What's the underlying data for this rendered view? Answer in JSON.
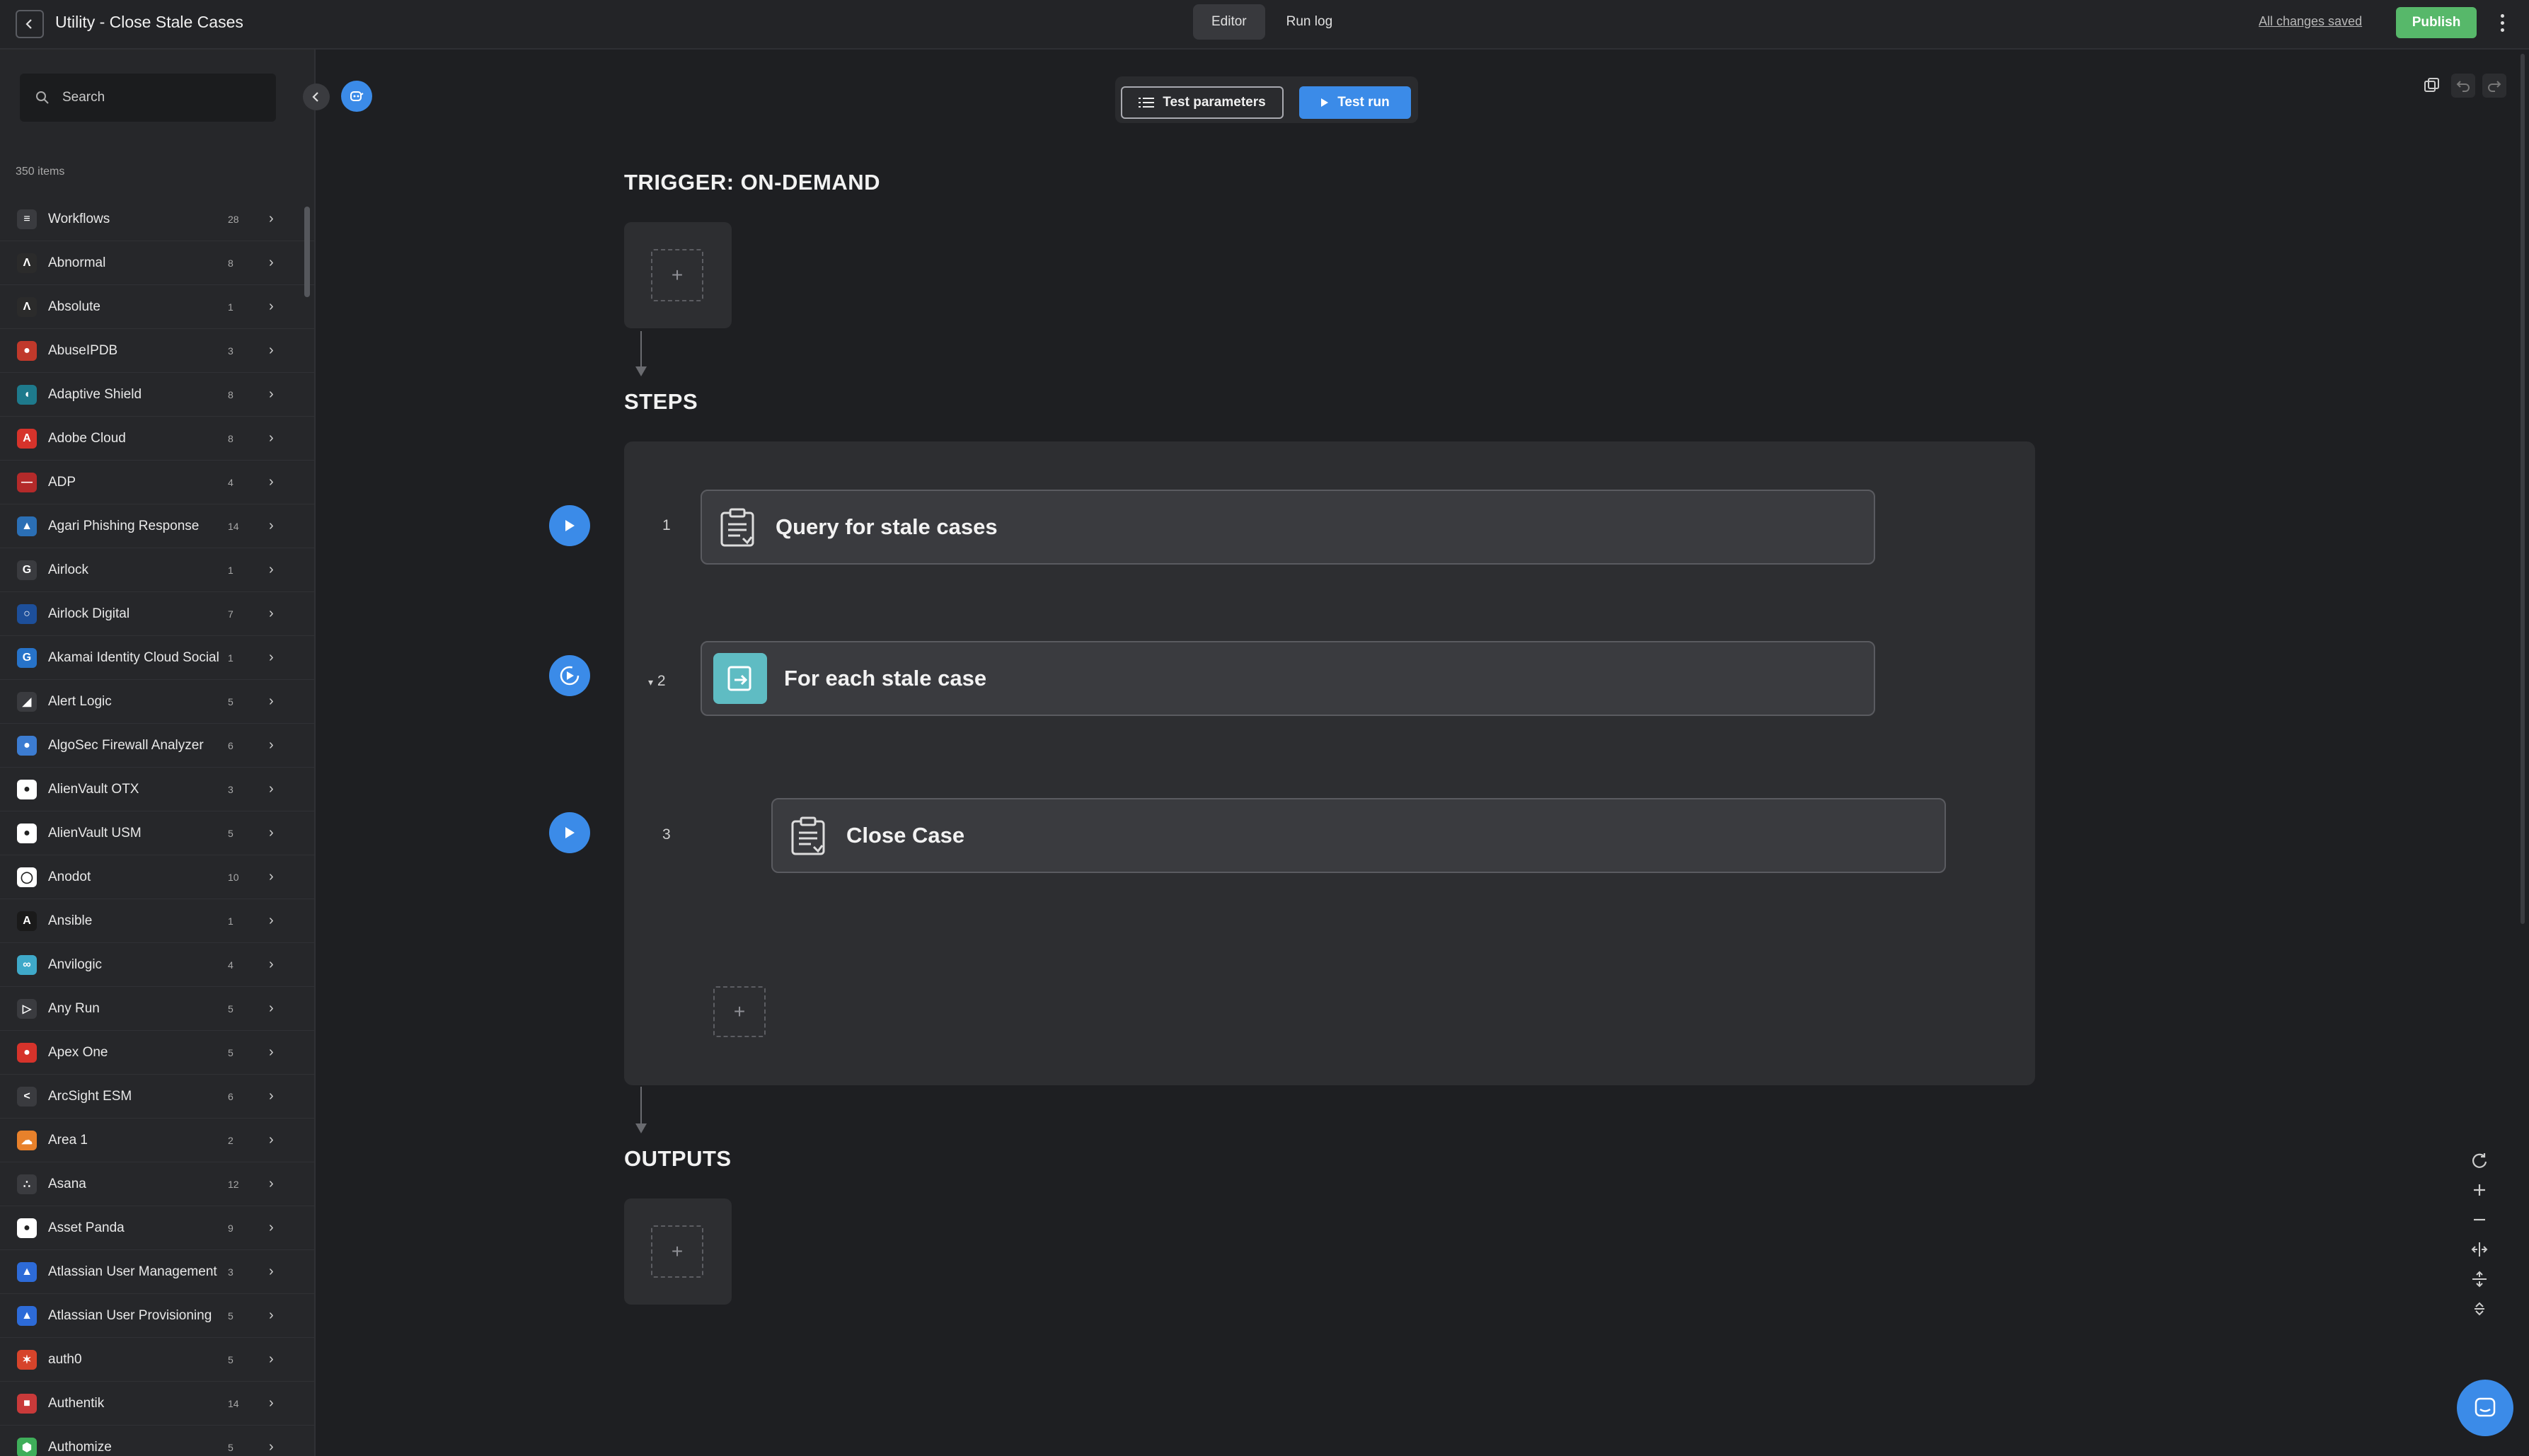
{
  "header": {
    "title": "Utility - Close Stale Cases",
    "tabs": [
      "Editor",
      "Run log"
    ],
    "saved_status": "All changes saved",
    "publish_label": "Publish"
  },
  "sidebar": {
    "search_placeholder": "Search",
    "count_label": "350 items",
    "items": [
      {
        "label": "Workflows",
        "count": "28",
        "color": "#3a3b3f",
        "glyph": "≡"
      },
      {
        "label": "Abnormal",
        "count": "8",
        "color": "#2b2b2b",
        "glyph": "Λ"
      },
      {
        "label": "Absolute",
        "count": "1",
        "color": "#2b2b2b",
        "glyph": "Λ"
      },
      {
        "label": "AbuseIPDB",
        "count": "3",
        "color": "#c0392b",
        "glyph": "●"
      },
      {
        "label": "Adaptive Shield",
        "count": "8",
        "color": "#1e7a8c",
        "glyph": "◖"
      },
      {
        "label": "Adobe Cloud",
        "count": "8",
        "color": "#d6332b",
        "glyph": "A"
      },
      {
        "label": "ADP",
        "count": "4",
        "color": "#b42a2a",
        "glyph": "—"
      },
      {
        "label": "Agari Phishing Response",
        "count": "14",
        "color": "#2b6fb5",
        "glyph": "▲"
      },
      {
        "label": "Airlock",
        "count": "1",
        "color": "#3a3b3f",
        "glyph": "G"
      },
      {
        "label": "Airlock Digital",
        "count": "7",
        "color": "#1d4f9a",
        "glyph": "○"
      },
      {
        "label": "Akamai Identity Cloud Social",
        "count": "1",
        "color": "#2773c9",
        "glyph": "G"
      },
      {
        "label": "Alert Logic",
        "count": "5",
        "color": "#3a3b3f",
        "glyph": "◢"
      },
      {
        "label": "AlgoSec Firewall Analyzer",
        "count": "6",
        "color": "#3c7cd1",
        "glyph": "●"
      },
      {
        "label": "AlienVault OTX",
        "count": "3",
        "color": "#ffffff",
        "glyph": "●"
      },
      {
        "label": "AlienVault USM",
        "count": "5",
        "color": "#ffffff",
        "glyph": "●"
      },
      {
        "label": "Anodot",
        "count": "10",
        "color": "#ffffff",
        "glyph": "◯"
      },
      {
        "label": "Ansible",
        "count": "1",
        "color": "#1a1a1a",
        "glyph": "A"
      },
      {
        "label": "Anvilogic",
        "count": "4",
        "color": "#3fa9c9",
        "glyph": "∞"
      },
      {
        "label": "Any Run",
        "count": "5",
        "color": "#3a3b3f",
        "glyph": "▷"
      },
      {
        "label": "Apex One",
        "count": "5",
        "color": "#d6332b",
        "glyph": "●"
      },
      {
        "label": "ArcSight ESM",
        "count": "6",
        "color": "#3a3b3f",
        "glyph": "<"
      },
      {
        "label": "Area 1",
        "count": "2",
        "color": "#e8812b",
        "glyph": "☁"
      },
      {
        "label": "Asana",
        "count": "12",
        "color": "#3a3b3f",
        "glyph": "∴"
      },
      {
        "label": "Asset Panda",
        "count": "9",
        "color": "#ffffff",
        "glyph": "●"
      },
      {
        "label": "Atlassian User Management",
        "count": "3",
        "color": "#2d6bd8",
        "glyph": "▲"
      },
      {
        "label": "Atlassian User Provisioning",
        "count": "5",
        "color": "#2d6bd8",
        "glyph": "▲"
      },
      {
        "label": "auth0",
        "count": "5",
        "color": "#d6442b",
        "glyph": "✶"
      },
      {
        "label": "Authentik",
        "count": "14",
        "color": "#c93a3a",
        "glyph": "■"
      },
      {
        "label": "Authomize",
        "count": "5",
        "color": "#3fae5a",
        "glyph": "⬢"
      }
    ]
  },
  "toolbar": {
    "test_parameters_label": "Test parameters",
    "test_run_label": "Test run"
  },
  "canvas": {
    "trigger_title": "TRIGGER: ON-DEMAND",
    "steps_title": "STEPS",
    "outputs_title": "OUTPUTS",
    "steps": [
      {
        "number": "1",
        "title": "Query for stale cases",
        "type": "action"
      },
      {
        "number": "2",
        "title": "For each stale case",
        "type": "loop"
      },
      {
        "number": "3",
        "title": "Close Case",
        "type": "action"
      }
    ]
  },
  "colors": {
    "accent": "#3b8be8",
    "publish": "#57b86a",
    "loop_icon": "#5fbcc3"
  }
}
